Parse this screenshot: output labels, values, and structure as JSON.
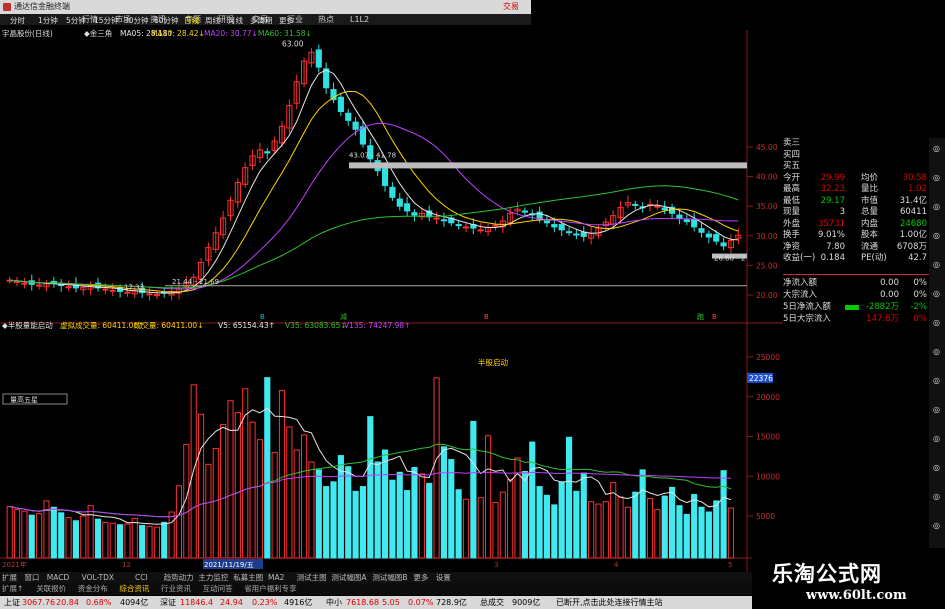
{
  "app": {
    "title": "通达信金融终端",
    "trade": "交易"
  },
  "menu": [
    "行情",
    "市场",
    "资讯",
    "专题",
    "研报",
    "交易",
    "行业",
    "热点",
    "L1L2"
  ],
  "timeframes": [
    {
      "label": "分时",
      "on": false
    },
    {
      "label": "1分钟",
      "on": false
    },
    {
      "label": "5分钟",
      "on": false
    },
    {
      "label": "15分钟",
      "on": false
    },
    {
      "label": "30分钟",
      "on": false
    },
    {
      "label": "60分钟",
      "on": false
    },
    {
      "label": "日线",
      "on": true
    },
    {
      "label": "周线",
      "on": false
    },
    {
      "label": "月线",
      "on": false
    },
    {
      "label": "多周期",
      "on": false
    },
    {
      "label": "更多",
      "on": false
    }
  ],
  "ma_bar": {
    "stock": "宇晶股份(日线)",
    "indicator": "◆金三角",
    "items": [
      {
        "text": "MA05: 28.18↑",
        "color": "#e6e6e6"
      },
      {
        "text": "MA10: 28.42↓",
        "color": "#ffd400"
      },
      {
        "text": "MA20: 30.77↓",
        "color": "#c040ff"
      },
      {
        "text": "MA60: 31.58↓",
        "color": "#30c030"
      }
    ]
  },
  "price_annotations": {
    "high": "63.00",
    "range": "43.07 - 41.78",
    "low_left": "17.33",
    "bottom_band": "21.44 - 21.69",
    "right_band": "26.60 - 2"
  },
  "price_axis": [
    "45.00",
    "40.00",
    "35.00",
    "30.00",
    "25.00",
    "20.00"
  ],
  "signals": [
    {
      "text": "B",
      "color": "#00d0c0"
    },
    {
      "text": "减",
      "color": "#30c030"
    },
    {
      "text": "B",
      "color": "#ff4040"
    },
    {
      "text": "跑",
      "color": "#30c030"
    },
    {
      "text": "B",
      "color": "#ff4040"
    }
  ],
  "vol_bar": {
    "label": "◆半股量能启动",
    "items": [
      {
        "text": "虚拟成交量: 60411.00↑",
        "color": "#ffd400"
      },
      {
        "text": "成交量: 60411.00↓",
        "color": "#ffd400"
      },
      {
        "text": "V5: 65154.43↑",
        "color": "#e6e6e6"
      },
      {
        "text": "V35: 63083.65↓",
        "color": "#30c030"
      },
      {
        "text": "V135: 74247.98↑",
        "color": "#c040ff"
      }
    ],
    "annotation": "半股启动",
    "small_box": "量高五星",
    "value_tag": "22376"
  },
  "volume_axis": [
    "25000",
    "20000",
    "15000",
    "10000",
    "5000"
  ],
  "date_labels": [
    {
      "text": "2021年"
    },
    {
      "text": "12"
    },
    {
      "text": "2021/11/19/五",
      "hl": true
    },
    {
      "text": "3"
    },
    {
      "text": "4"
    },
    {
      "text": "5"
    }
  ],
  "right_panel": {
    "rows": [
      {
        "l": "卖三",
        "lv": "",
        "r": "",
        "rv": ""
      },
      {
        "l": "买四",
        "lv": "",
        "r": "",
        "rv": ""
      },
      {
        "l": "买五",
        "lv": "",
        "r": "",
        "rv": ""
      },
      {
        "l": "今开",
        "lv": "29.99",
        "lvc": "#d00",
        "r": "均价",
        "rv": "30.58",
        "rvc": "#d00"
      },
      {
        "l": "最高",
        "lv": "32.23",
        "lvc": "#d00",
        "r": "量比",
        "rv": "1.02",
        "rvc": "#d00"
      },
      {
        "l": "最低",
        "lv": "29.17",
        "lvc": "#0c0",
        "r": "市值",
        "rv": "31.4亿",
        "rvc": "#ddd"
      },
      {
        "l": "现量",
        "lv": "3",
        "lvc": "#ddd",
        "r": "总量",
        "rv": "60411",
        "rvc": "#ddd"
      },
      {
        "l": "外盘",
        "lv": "35731",
        "lvc": "#d00",
        "r": "内盘",
        "rv": "24680",
        "rvc": "#0c0"
      },
      {
        "l": "换手",
        "lv": "9.01%",
        "lvc": "#ddd",
        "r": "股本",
        "rv": "1.00亿",
        "rvc": "#ddd"
      },
      {
        "l": "净资",
        "lv": "7.80",
        "lvc": "#ddd",
        "r": "流通",
        "rv": "6708万",
        "rvc": "#ddd"
      },
      {
        "l": "收益(一)",
        "lv": "0.184",
        "lvc": "#ddd",
        "r": "PE(动)",
        "rv": "42.7",
        "rvc": "#ddd"
      }
    ],
    "flow": [
      {
        "l": "净流入额",
        "v": "0.00",
        "p": "0%",
        "c": "#ddd"
      },
      {
        "l": "大宗流入",
        "v": "0.00",
        "p": "0%",
        "c": "#ddd"
      },
      {
        "l": "5日净流入额",
        "v": "-2882万",
        "p": "-2%",
        "c": "#0c0"
      },
      {
        "l": "5日大宗流入",
        "v": "147.8万",
        "p": "0%",
        "c": "#d00"
      }
    ]
  },
  "sidebar_glyphs": [
    "◎",
    "◎",
    "◎",
    "◎",
    "◎",
    "◎",
    "◎",
    "◎",
    "◎",
    "◎",
    "◎",
    "◎",
    "◎",
    "◎"
  ],
  "tabs_row1": [
    {
      "t": "2021年"
    },
    {
      "t": "12"
    },
    {
      "t": "2021/11/19/五",
      "hl": true
    },
    {
      "t": "3"
    },
    {
      "t": "4"
    },
    {
      "t": "5"
    },
    {
      "t": "模板"
    }
  ],
  "tabs_row2": [
    {
      "t": "扩展"
    },
    {
      "t": "窗口"
    },
    {
      "t": "MACD"
    },
    {
      "t": "VOL-TDX"
    },
    {
      "t": "CCI"
    },
    {
      "t": "趋势动力"
    },
    {
      "t": "主力监控"
    },
    {
      "t": "私募主图"
    },
    {
      "t": "MA2"
    },
    {
      "t": "测试主图"
    },
    {
      "t": "测试幅图A"
    },
    {
      "t": "测试幅图B"
    },
    {
      "t": "更多"
    },
    {
      "t": "设置"
    }
  ],
  "tabs_row3": [
    {
      "t": "扩展↑"
    },
    {
      "t": "关联报价"
    },
    {
      "t": "资金分布"
    },
    {
      "t": "综合资讯",
      "hl": true
    },
    {
      "t": "行业资讯"
    },
    {
      "t": "互动问答"
    },
    {
      "t": "省用户福利专享"
    }
  ],
  "status": {
    "items": [
      {
        "t": "上证",
        "c": "#000"
      },
      {
        "t": "3067.76",
        "c": "#d00"
      },
      {
        "t": "20.84",
        "c": "#d00"
      },
      {
        "t": "0.68%",
        "c": "#d00"
      },
      {
        "t": "4094亿",
        "c": "#000"
      },
      {
        "t": "深证",
        "c": "#000"
      },
      {
        "t": "11846.4",
        "c": "#d00"
      },
      {
        "t": "24.94",
        "c": "#d00"
      },
      {
        "t": "0.23%",
        "c": "#d00"
      },
      {
        "t": "4916亿",
        "c": "#000"
      },
      {
        "t": "中小",
        "c": "#000"
      },
      {
        "t": "7618.68",
        "c": "#d00"
      },
      {
        "t": "5.05",
        "c": "#d00"
      },
      {
        "t": "0.07%",
        "c": "#d00"
      },
      {
        "t": "728.9亿",
        "c": "#000"
      },
      {
        "t": "总成交",
        "c": "#000"
      },
      {
        "t": "9009亿",
        "c": "#000"
      },
      {
        "t": "已断开,点击此处连接行情主站",
        "c": "#000"
      }
    ]
  },
  "watermark": {
    "line1": "乐淘公式网",
    "line2": "www.60lt.com"
  },
  "corner_label": "固定F10"
}
